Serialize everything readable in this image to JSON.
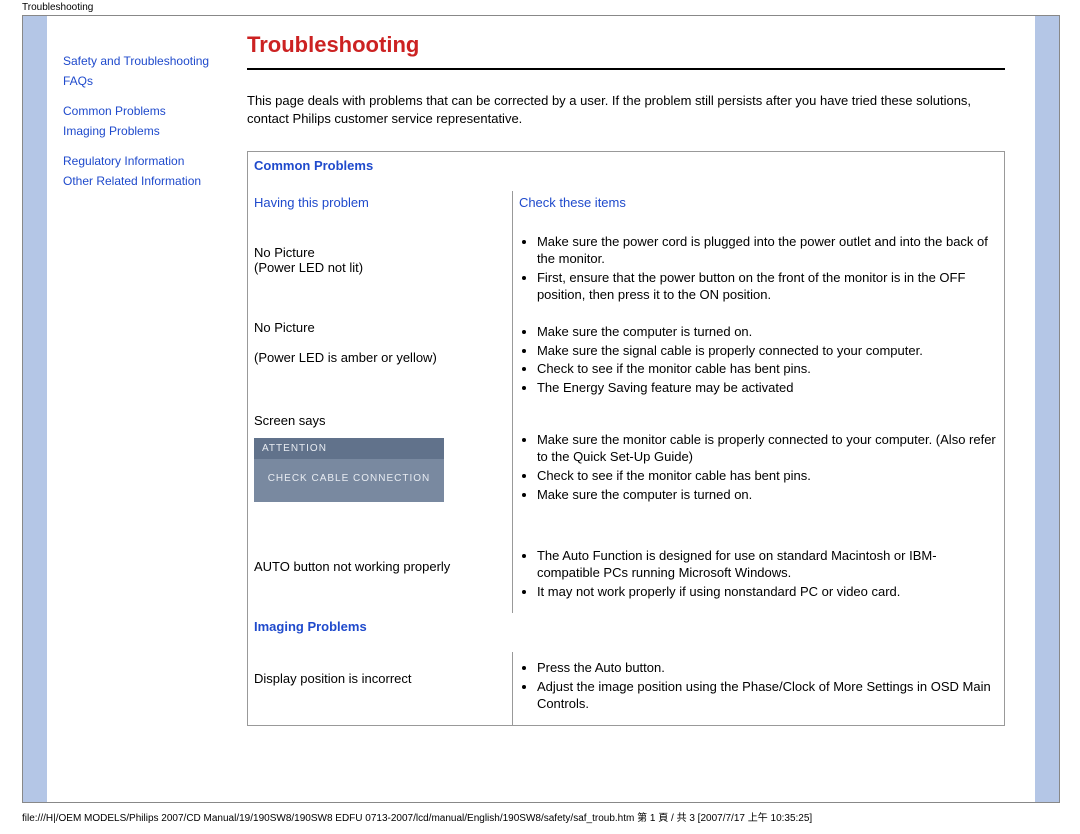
{
  "meta": {
    "tab_title": "Troubleshooting"
  },
  "sidebar": {
    "links": [
      {
        "label": "Safety and Troubleshooting"
      },
      {
        "label": "FAQs"
      },
      {
        "label": "Common Problems"
      },
      {
        "label": "Imaging Problems"
      },
      {
        "label": "Regulatory Information"
      },
      {
        "label": "Other Related Information"
      }
    ]
  },
  "main": {
    "title": "Troubleshooting",
    "intro": "This page deals with problems that can be corrected by a user. If the problem still persists after you have tried these solutions, contact Philips customer service representative.",
    "sections": {
      "common": {
        "heading": "Common Problems",
        "col_problem": "Having this problem",
        "col_check": "Check these items",
        "rows": [
          {
            "problem_line1": "No Picture",
            "problem_line2": "(Power LED not lit)",
            "checks": [
              "Make sure the power cord is plugged into the power outlet and into the back of the monitor.",
              "First, ensure that the power button on the front of the monitor is in the OFF position, then press it to the ON position."
            ]
          },
          {
            "problem_line1": "No Picture",
            "problem_line2": "(Power LED is amber or yellow)",
            "checks": [
              "Make sure the computer is turned on.",
              "Make sure the signal cable is properly connected to your computer.",
              "Check to see if the monitor cable has bent pins.",
              "The Energy Saving feature may be activated"
            ]
          },
          {
            "problem_line1": "Screen says",
            "attention_title": "ATTENTION",
            "attention_body": "CHECK CABLE CONNECTION",
            "checks": [
              "Make sure the monitor cable is properly connected to your computer. (Also refer to the Quick Set-Up Guide)",
              "Check to see if the monitor cable has bent pins.",
              "Make sure the computer is turned on."
            ]
          },
          {
            "problem_line1": "AUTO button not working properly",
            "checks": [
              "The Auto Function is designed for use on standard Macintosh or IBM-compatible PCs running Microsoft Windows.",
              "It may not work properly if using nonstandard PC or video card."
            ]
          }
        ]
      },
      "imaging": {
        "heading": "Imaging Problems",
        "rows": [
          {
            "problem_line1": "Display position is incorrect",
            "checks": [
              "Press the Auto button.",
              "Adjust the image position using the Phase/Clock of More Settings in OSD Main Controls."
            ]
          }
        ]
      }
    }
  },
  "footer": "file:///H|/OEM MODELS/Philips 2007/CD Manual/19/190SW8/190SW8 EDFU 0713-2007/lcd/manual/English/190SW8/safety/saf_troub.htm 第 1 頁 / 共 3  [2007/7/17 上午 10:35:25]"
}
